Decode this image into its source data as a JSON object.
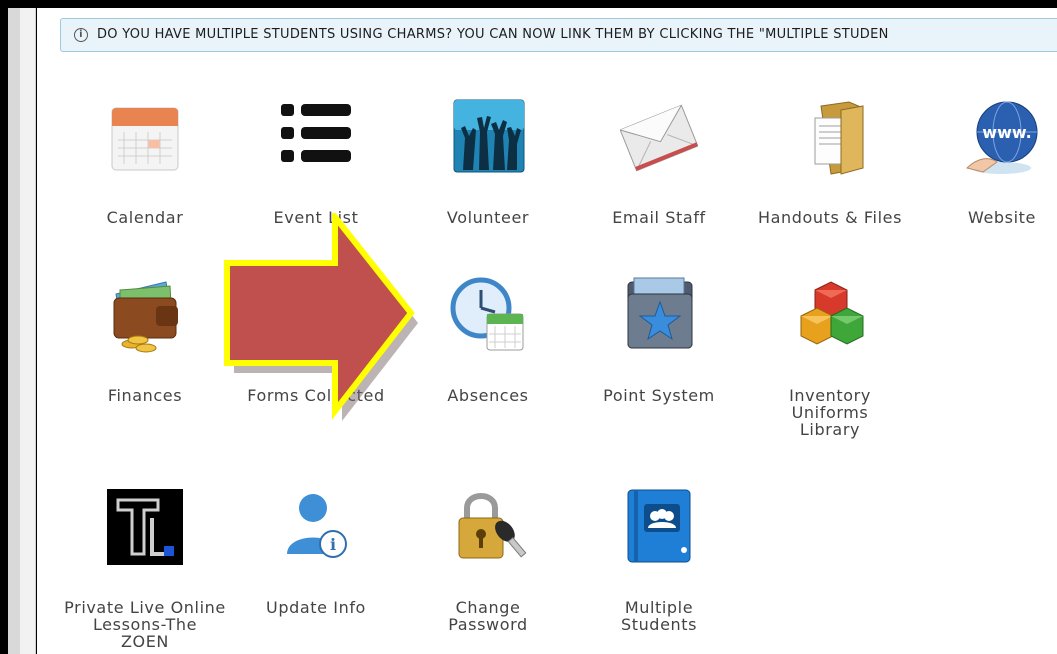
{
  "notice": {
    "text": "DO YOU HAVE MULTIPLE STUDENTS USING CHARMS? YOU CAN NOW LINK THEM BY CLICKING THE \"MULTIPLE STUDEN",
    "icon": "info-icon"
  },
  "tiles": [
    {
      "label": "Calendar",
      "icon": "calendar-icon"
    },
    {
      "label": "Event List",
      "icon": "list-icon"
    },
    {
      "label": "Volunteer",
      "icon": "volunteer-hands-icon"
    },
    {
      "label": "Email Staff",
      "icon": "envelope-icon"
    },
    {
      "label": "Handouts & Files",
      "icon": "folder-icon"
    },
    {
      "label": "Website",
      "icon": "globe-icon"
    },
    {
      "label": "Finances",
      "icon": "wallet-icon"
    },
    {
      "label": "Forms Collected",
      "icon": "forms-icon"
    },
    {
      "label": "Absences",
      "icon": "clock-calendar-icon"
    },
    {
      "label": "Point System",
      "icon": "star-folder-icon"
    },
    {
      "label": "Inventory\nUniforms\nLibrary",
      "icon": "boxes-icon"
    },
    {
      "label": "Private Live Online\nLessons-The\nZOEN",
      "icon": "zoen-logo-icon"
    },
    {
      "label": "Update Info",
      "icon": "user-info-icon"
    },
    {
      "label": "Change\nPassword",
      "icon": "padlock-key-icon"
    },
    {
      "label": "Multiple\nStudents",
      "icon": "group-book-icon"
    }
  ],
  "colors": {
    "arrow_fill": "#c0504d",
    "arrow_outline": "#ffff00",
    "notice_bg": "#e9f4fa",
    "notice_border": "#9fc8e0"
  }
}
